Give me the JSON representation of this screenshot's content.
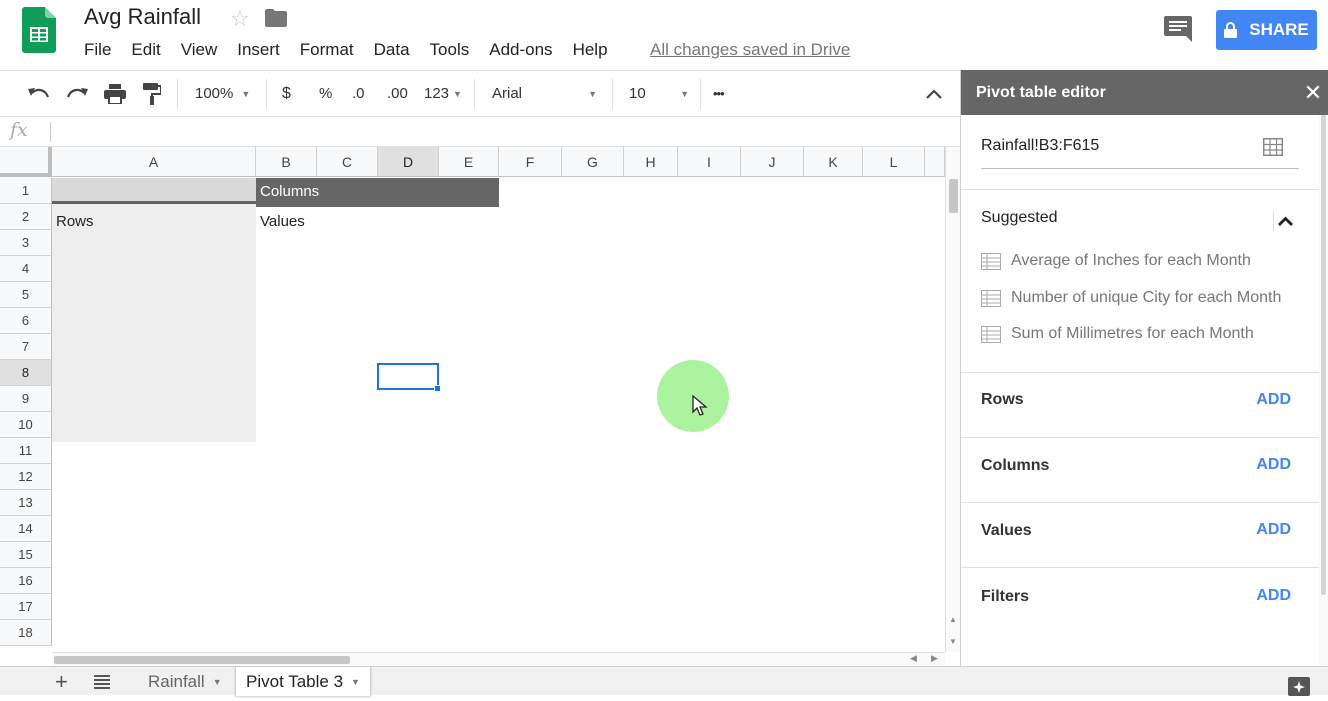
{
  "app": {
    "doc_title": "Avg Rainfall",
    "save_status": "All changes saved in Drive",
    "share_label": "SHARE"
  },
  "menu": [
    "File",
    "Edit",
    "View",
    "Insert",
    "Format",
    "Data",
    "Tools",
    "Add-ons",
    "Help"
  ],
  "toolbar": {
    "zoom": "100%",
    "currency": "$",
    "percent": "%",
    "decrease_decimal": ".0",
    "increase_decimal": ".00",
    "number_format": "123",
    "font": "Arial",
    "font_size": "10",
    "more": "•••"
  },
  "formula_bar": {
    "fx_label": "fx",
    "value": ""
  },
  "grid": {
    "columns": [
      "A",
      "B",
      "C",
      "D",
      "E",
      "F",
      "G",
      "H",
      "I",
      "J",
      "K",
      "L"
    ],
    "rows": [
      "1",
      "2",
      "3",
      "4",
      "5",
      "6",
      "7",
      "8",
      "9",
      "10",
      "11",
      "12",
      "13",
      "14",
      "15",
      "16",
      "17",
      "18"
    ],
    "selected_column": "D",
    "selected_row": "8",
    "cells": {
      "b1": "Columns",
      "a2": "Rows",
      "b2": "Values"
    }
  },
  "sheets": {
    "tabs": [
      "Rainfall",
      "Pivot Table 3"
    ],
    "active": "Pivot Table 3"
  },
  "panel": {
    "title": "Pivot table editor",
    "close": "✕",
    "range": "Rainfall!B3:F615",
    "suggested_title": "Suggested",
    "suggestions": [
      "Average of Inches for each Month",
      "Number of unique City for each Month",
      "Sum of Millimetres for each Month"
    ],
    "sections": [
      {
        "title": "Rows",
        "add": "ADD"
      },
      {
        "title": "Columns",
        "add": "ADD"
      },
      {
        "title": "Values",
        "add": "ADD"
      },
      {
        "title": "Filters",
        "add": "ADD"
      }
    ]
  },
  "colors": {
    "accent_blue": "#4285f4",
    "sheets_green": "#0f9d58",
    "pivot_header_gray": "#666666",
    "cursor_highlight": "#a8f29a"
  },
  "icons": [
    "sheets-logo-icon",
    "star-icon",
    "folder-icon",
    "comment-icon",
    "lock-icon",
    "undo-icon",
    "redo-icon",
    "print-icon",
    "paint-format-icon",
    "chevron-up-icon",
    "table-grid-icon",
    "cursor-arrow-icon"
  ]
}
